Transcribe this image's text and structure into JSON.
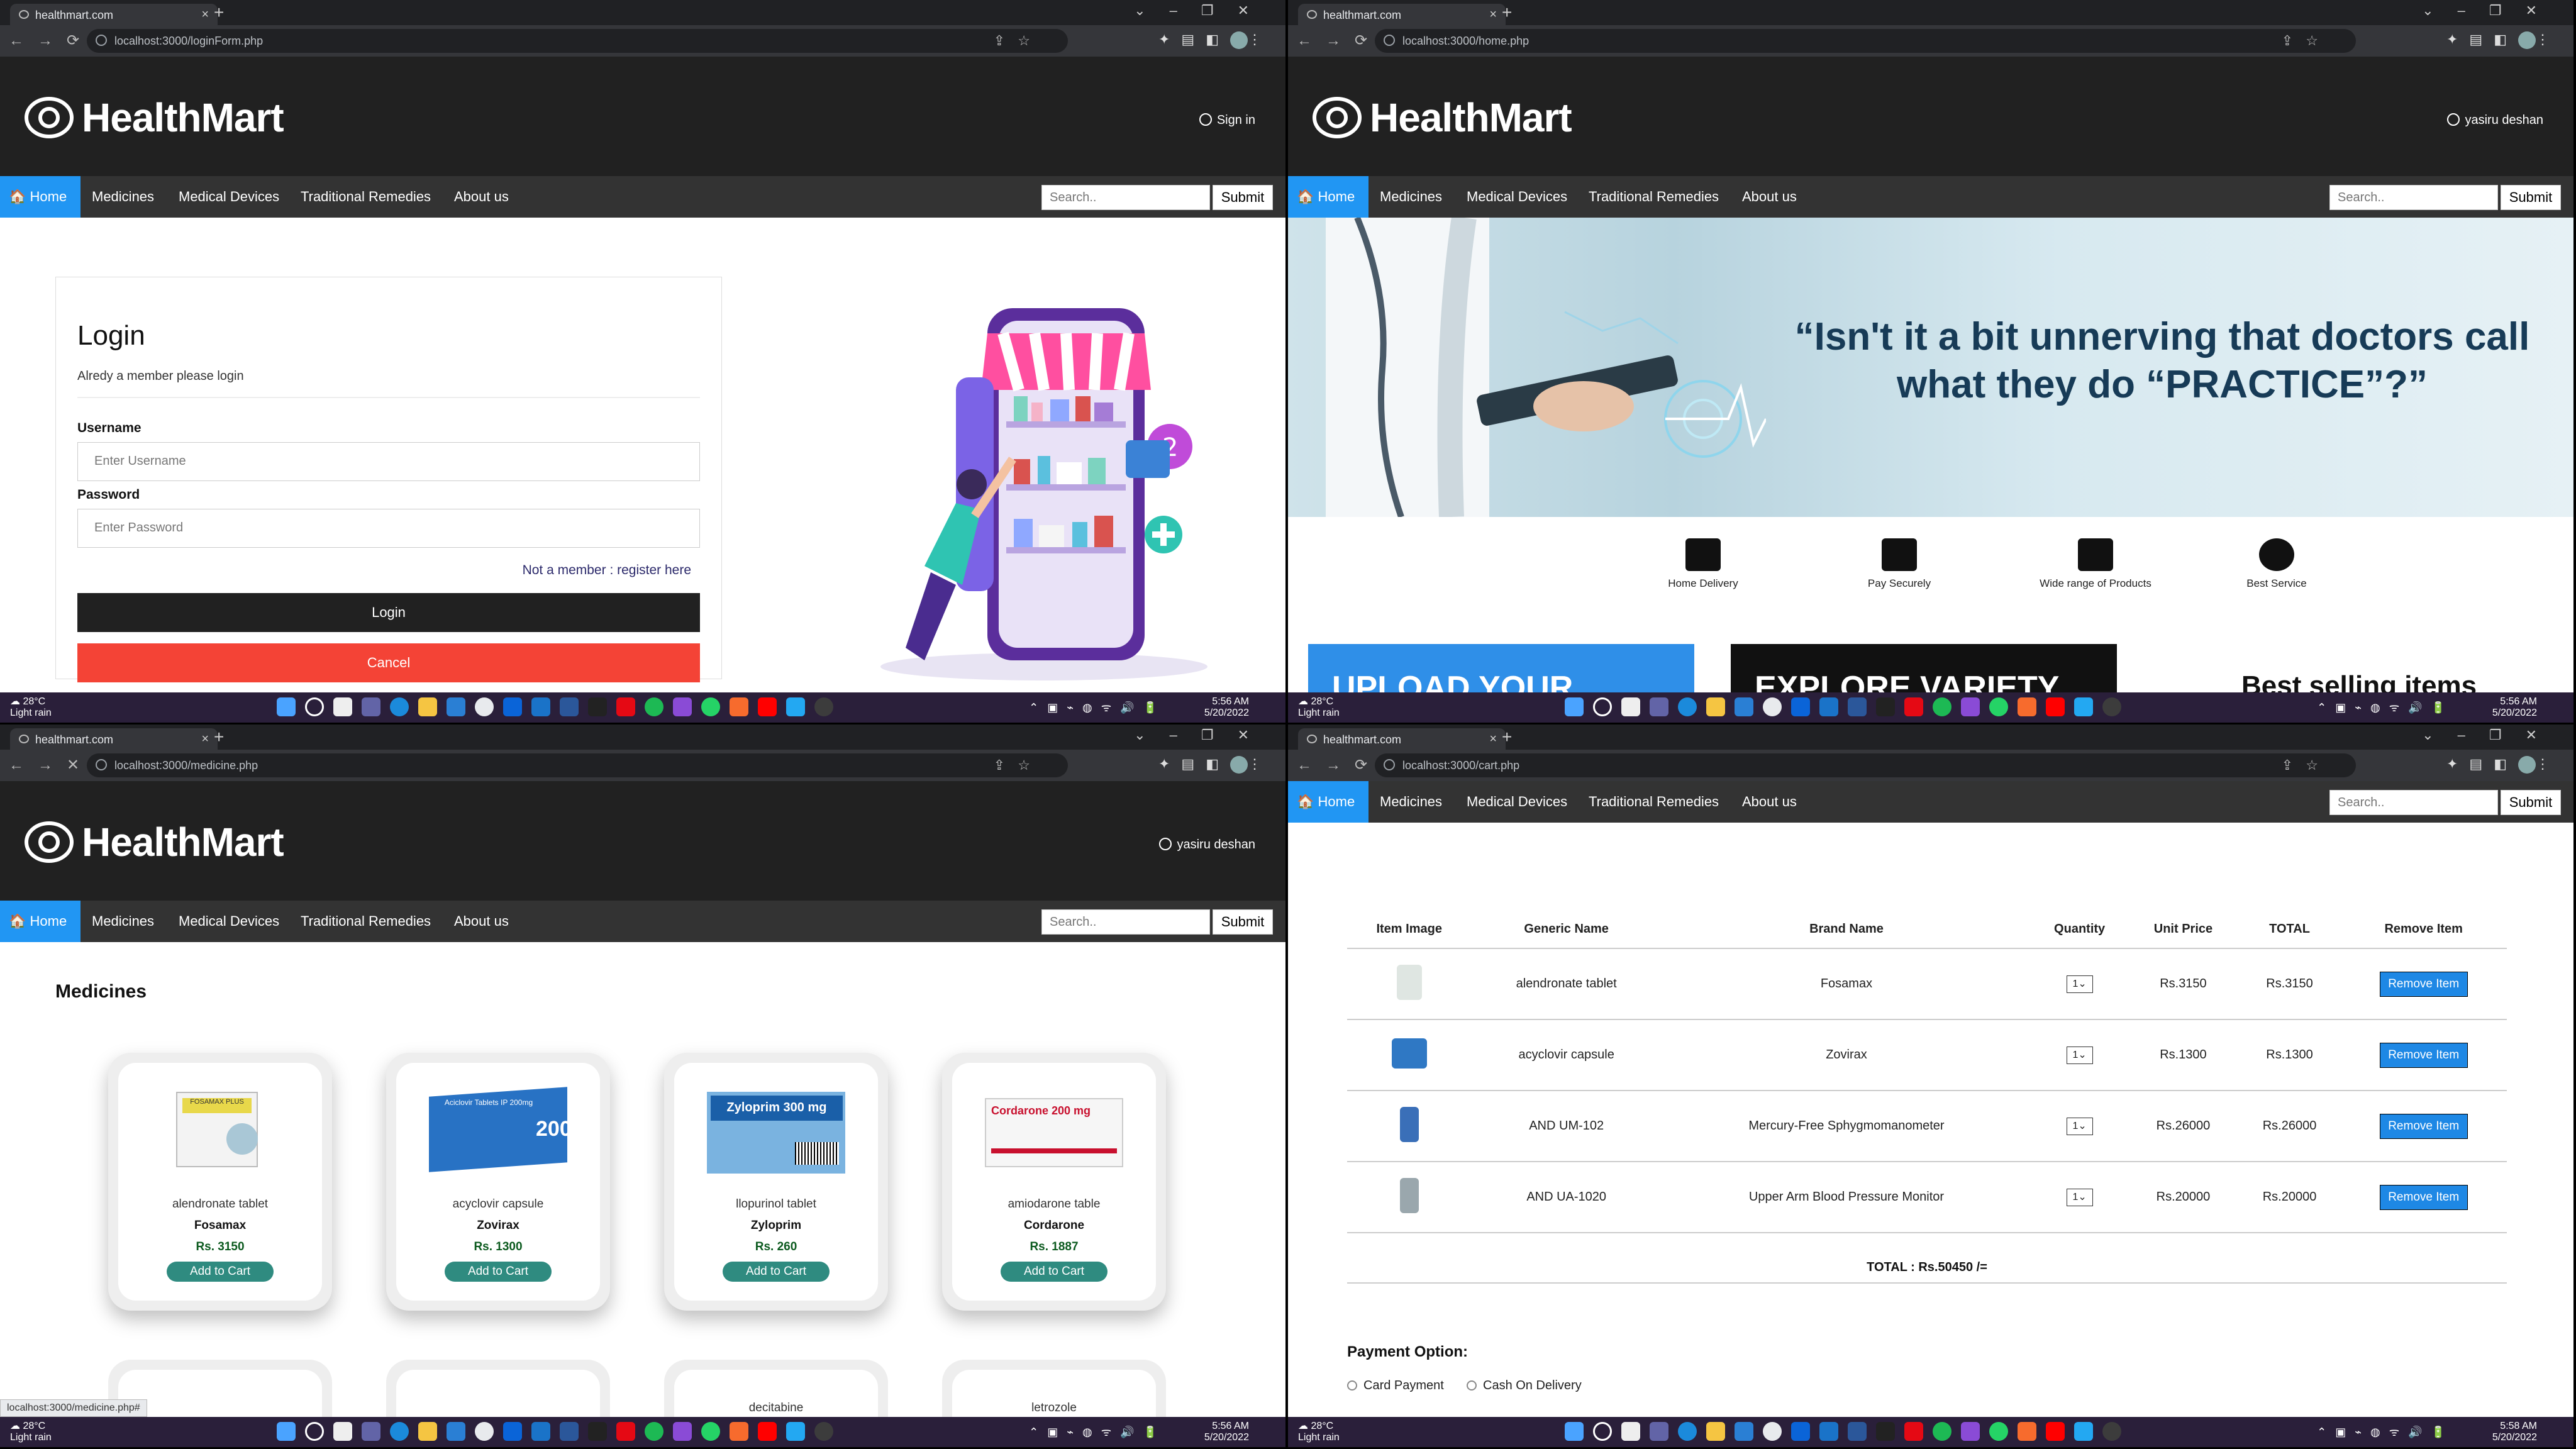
{
  "browser": {
    "tab_title": "healthmart.com",
    "new_tab": "+",
    "urls": [
      "localhost:3000/loginForm.php",
      "localhost:3000/home.php",
      "localhost:3000/medicine.php",
      "localhost:3000/cart.php"
    ]
  },
  "site": {
    "brand": "HealthMart",
    "nav": [
      "Home",
      "Medicines",
      "Medical Devices",
      "Traditional Remedies",
      "About us"
    ],
    "search_placeholder": "Search..",
    "submit": "Submit",
    "sign_in": "Sign in",
    "user": "yasiru deshan"
  },
  "login": {
    "title": "Login",
    "subtitle": "Alredy a member please login",
    "username_label": "Username",
    "username_placeholder": "Enter Username",
    "password_label": "Password",
    "password_placeholder": "Enter Password",
    "register_link": "Not a member : register here",
    "login_btn": "Login",
    "cancel_btn": "Cancel"
  },
  "home": {
    "quote_line1": "“Isn't it a bit unnerving that doctors call",
    "quote_line2": "what they do “PRACTICE”?”",
    "features": [
      "Home Delivery",
      "Pay Securely",
      "Wide range of Products",
      "Best Service"
    ],
    "promo1": "UPLOAD YOUR",
    "promo2": "EXPLORE VARIETY OF",
    "best_selling": "Best selling items"
  },
  "medicines": {
    "title": "Medicines",
    "add_to_cart": "Add to Cart",
    "items": [
      {
        "generic": "alendronate tablet",
        "brand": "Fosamax",
        "price": "Rs. 3150",
        "pack": "FOSAMAX PLUS"
      },
      {
        "generic": "acyclovir capsule",
        "brand": "Zovirax",
        "price": "Rs. 1300",
        "pack": "Aciclovir Tablets IP 200mg"
      },
      {
        "generic": "llopurinol tablet",
        "brand": "Zyloprim",
        "price": "Rs. 260",
        "pack": "Zyloprim 300 mg"
      },
      {
        "generic": "amiodarone table",
        "brand": "Cordarone",
        "price": "Rs. 1887",
        "pack": "Cordarone 200 mg"
      }
    ],
    "row2": [
      "",
      "",
      "decitabine",
      "letrozole"
    ],
    "status_url": "localhost:3000/medicine.php#"
  },
  "cart": {
    "headers": [
      "Item Image",
      "Generic Name",
      "Brand Name",
      "Quantity",
      "Unit Price",
      "TOTAL",
      "Remove Item"
    ],
    "rows": [
      {
        "generic": "alendronate tablet",
        "brand": "Fosamax",
        "qty": "1",
        "unit": "Rs.3150",
        "total": "Rs.3150"
      },
      {
        "generic": "acyclovir capsule",
        "brand": "Zovirax",
        "qty": "1",
        "unit": "Rs.1300",
        "total": "Rs.1300"
      },
      {
        "generic": "AND UM-102",
        "brand": "Mercury-Free Sphygmomanometer",
        "qty": "1",
        "unit": "Rs.26000",
        "total": "Rs.26000"
      },
      {
        "generic": "AND UA-1020",
        "brand": "Upper Arm Blood Pressure Monitor",
        "qty": "1",
        "unit": "Rs.20000",
        "total": "Rs.20000"
      }
    ],
    "remove_btn": "Remove Item",
    "grand_total": "TOTAL : Rs.50450 /=",
    "payment_title": "Payment Option:",
    "payment_options": [
      "Card Payment",
      "Cash On Delivery"
    ]
  },
  "taskbar": {
    "temp": "28°C",
    "weather": "Light rain",
    "time": "5:56 AM",
    "time_last": "5:58 AM",
    "date": "5/20/2022"
  },
  "colors": {
    "nav_bg": "#333333",
    "header_bg": "#212121",
    "accent": "#2196f3",
    "cancel": "#f44336",
    "login_btn": "#212121",
    "add_to_cart": "#2f8b80"
  }
}
